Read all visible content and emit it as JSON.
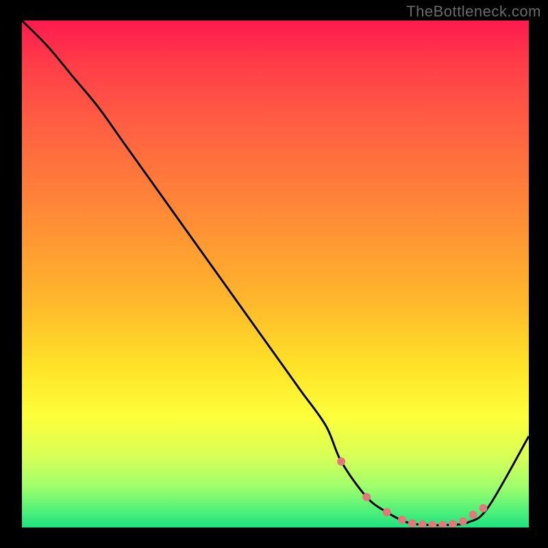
{
  "watermark": "TheBottleneck.com",
  "chart_data": {
    "type": "line",
    "title": "",
    "xlabel": "",
    "ylabel": "",
    "xlim": [
      0,
      100
    ],
    "ylim": [
      0,
      100
    ],
    "series": [
      {
        "name": "curve",
        "x": [
          0,
          5,
          10,
          15,
          20,
          25,
          30,
          35,
          40,
          45,
          50,
          55,
          60,
          63,
          68,
          72,
          76,
          80,
          84,
          88,
          92,
          100
        ],
        "values": [
          100,
          95,
          89,
          83,
          76,
          69,
          62,
          55,
          48,
          41,
          34,
          27,
          20,
          13,
          6,
          3,
          1,
          0.5,
          0.5,
          1,
          4,
          18
        ]
      }
    ],
    "markers": {
      "name": "points",
      "x": [
        63,
        68,
        72,
        75,
        77,
        79,
        81,
        83,
        85,
        87,
        89,
        91
      ],
      "values": [
        13,
        6,
        3,
        1.5,
        0.8,
        0.6,
        0.5,
        0.5,
        0.7,
        1.2,
        2.5,
        3.8
      ],
      "color": "#e07a7a",
      "radius": 6
    },
    "colors": {
      "curve": "#000000",
      "marker": "#e07a7a",
      "gradient_top": "#ff1a4e",
      "gradient_mid": "#ffe228",
      "gradient_bottom": "#1ee27e"
    }
  }
}
